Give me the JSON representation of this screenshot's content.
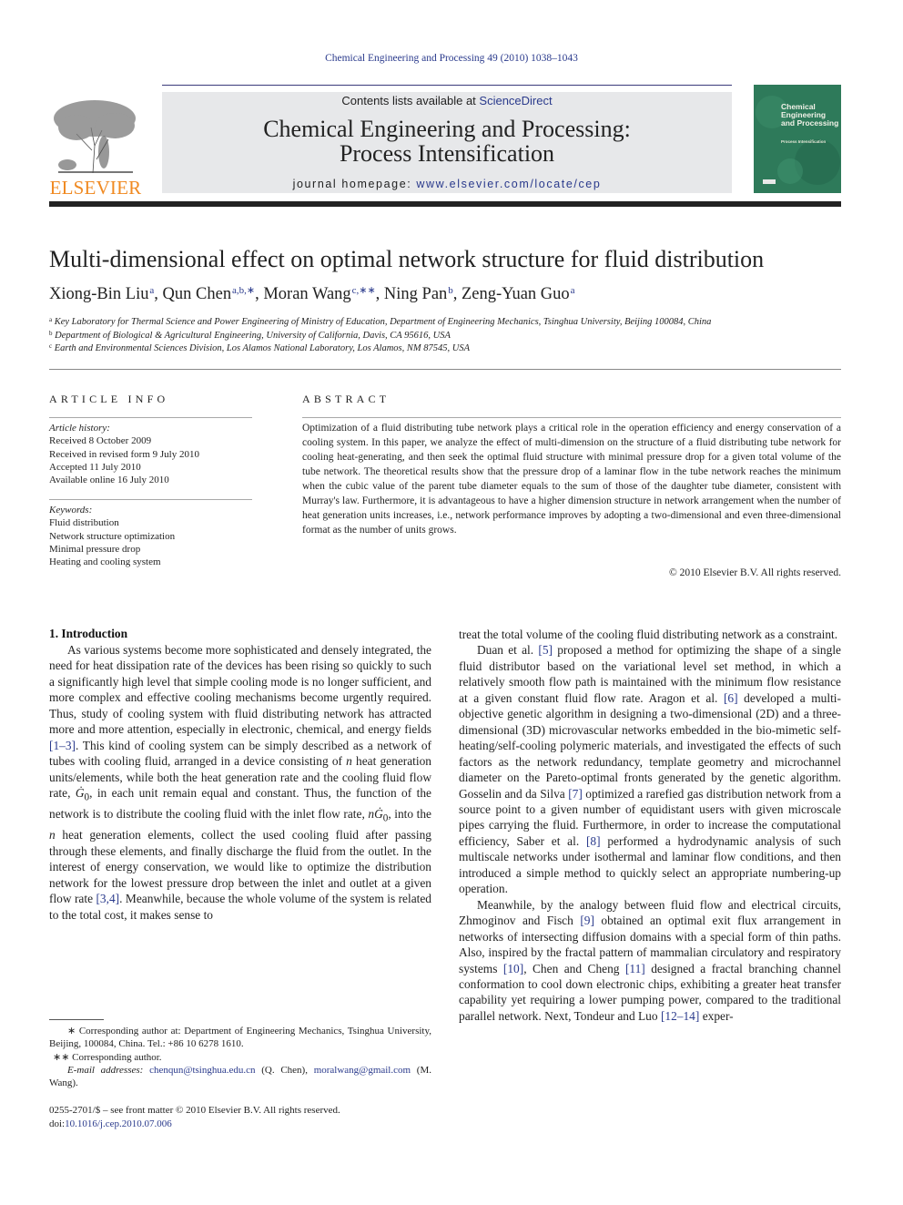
{
  "header": {
    "citation": "Chemical Engineering and Processing 49 (2010) 1038–1043",
    "contents_prefix": "Contents lists available at ",
    "contents_link": "ScienceDirect",
    "journal_title_line1": "Chemical Engineering and Processing:",
    "journal_title_line2": "Process Intensification",
    "homepage_prefix": "journal homepage: ",
    "homepage_url": "www.elsevier.com/locate/cep",
    "publisher_logo_text": "ELSEVIER",
    "cover_title": "Chemical Engineering and Processing",
    "cover_subtitle": "Process Intensification",
    "colors": {
      "publisher_orange": "#f08a22",
      "link_blue": "#2a3a8c",
      "masthead_gray": "#e7e8ea",
      "cover_green": "#2e7a5a"
    }
  },
  "article": {
    "title": "Multi-dimensional effect on optimal network structure for fluid distribution",
    "authors": [
      {
        "name": "Xiong-Bin Liu",
        "sup": "a"
      },
      {
        "name": "Qun Chen",
        "sup": "a,b,∗"
      },
      {
        "name": "Moran Wang",
        "sup": "c,∗∗"
      },
      {
        "name": "Ning Pan",
        "sup": "b"
      },
      {
        "name": "Zeng-Yuan Guo",
        "sup": "a"
      }
    ],
    "affiliations": [
      {
        "mark": "a",
        "text": "Key Laboratory for Thermal Science and Power Engineering of Ministry of Education, Department of Engineering Mechanics, Tsinghua University, Beijing 100084, China"
      },
      {
        "mark": "b",
        "text": "Department of Biological & Agricultural Engineering, University of California, Davis, CA 95616, USA"
      },
      {
        "mark": "c",
        "text": "Earth and Environmental Sciences Division, Los Alamos National Laboratory, Los Alamos, NM 87545, USA"
      }
    ]
  },
  "article_info": {
    "heading": "ARTICLE INFO",
    "history_label": "Article history:",
    "history": [
      "Received 8 October 2009",
      "Received in revised form 9 July 2010",
      "Accepted 11 July 2010",
      "Available online 16 July 2010"
    ],
    "keywords_label": "Keywords:",
    "keywords": [
      "Fluid distribution",
      "Network structure optimization",
      "Minimal pressure drop",
      "Heating and cooling system"
    ]
  },
  "abstract": {
    "heading": "ABSTRACT",
    "text": "Optimization of a fluid distributing tube network plays a critical role in the operation efficiency and energy conservation of a cooling system. In this paper, we analyze the effect of multi-dimension on the structure of a fluid distributing tube network for cooling heat-generating, and then seek the optimal fluid structure with minimal pressure drop for a given total volume of the tube network. The theoretical results show that the pressure drop of a laminar flow in the tube network reaches the minimum when the cubic value of the parent tube diameter equals to the sum of those of the daughter tube diameter, consistent with Murray's law. Furthermore, it is advantageous to have a higher dimension structure in network arrangement when the number of heat generation units increases, i.e., network performance improves by adopting a two-dimensional and even three-dimensional format as the number of units grows.",
    "copyright": "© 2010 Elsevier B.V. All rights reserved."
  },
  "body": {
    "section_heading": "1.  Introduction",
    "left": {
      "p1_a": "As various systems become more sophisticated and densely integrated, the need for heat dissipation rate of the devices has been rising so quickly to such a significantly high level that simple cooling mode is no longer sufficient, and more complex and effective cooling mechanisms become urgently required. Thus, study of cooling system with fluid distributing network has attracted more and more attention, especially in electronic, chemical, and energy fields ",
      "cite_1": "[1–3]",
      "p1_b": ". This kind of cooling system can be simply described as a network of tubes with cooling fluid, arranged in a device consisting of ",
      "n1": "n",
      "p1_c": " heat generation units/elements, while both the heat generation rate and the cooling fluid flow rate, ",
      "g0_1": "Ġ",
      "g0_sub": "0",
      "p1_d": ", in each unit remain equal and constant. Thus, the function of the network is to distribute the cooling fluid with the inlet flow rate, ",
      "n2": "n",
      "g0_2": "Ġ",
      "p1_e": ", into the ",
      "n3": "n",
      "p1_f": " heat generation elements, collect the used cooling fluid after passing through these elements, and finally discharge the fluid from the outlet. In the interest of energy conservation, we would like to optimize the distribution network for the lowest pressure drop between the inlet and outlet at a given flow rate ",
      "cite_2": "[3,4]",
      "p1_g": ". Meanwhile, because the whole volume of the system is related to the total cost, it makes sense to"
    },
    "right": {
      "p0": "treat the total volume of the cooling fluid distributing network as a constraint.",
      "p2_a": "Duan et al. ",
      "cite_5": "[5]",
      "p2_b": " proposed a method for optimizing the shape of a single fluid distributor based on the variational level set method, in which a relatively smooth flow path is maintained with the minimum flow resistance at a given constant fluid flow rate. Aragon et al. ",
      "cite_6": "[6]",
      "p2_c": " developed a multi-objective genetic algorithm in designing a two-dimensional (2D) and a three-dimensional (3D) microvascular networks embedded in the bio-mimetic self-heating/self-cooling polymeric materials, and investigated the effects of such factors as the network redundancy, template geometry and microchannel diameter on the Pareto-optimal fronts generated by the genetic algorithm. Gosselin and da Silva ",
      "cite_7": "[7]",
      "p2_d": " optimized a rarefied gas distribution network from a source point to a given number of equidistant users with given microscale pipes carrying the fluid. Furthermore, in order to increase the computational efficiency, Saber et al. ",
      "cite_8": "[8]",
      "p2_e": " performed a hydrodynamic analysis of such multiscale networks under isothermal and laminar flow conditions, and then introduced a simple method to quickly select an appropriate numbering-up operation.",
      "p3_a": "Meanwhile, by the analogy between fluid flow and electrical circuits, Zhmoginov and Fisch ",
      "cite_9": "[9]",
      "p3_b": " obtained an optimal exit flux arrangement in networks of intersecting diffusion domains with a special form of thin paths. Also, inspired by the fractal pattern of mammalian circulatory and respiratory systems ",
      "cite_10": "[10]",
      "p3_c": ", Chen and Cheng ",
      "cite_11": "[11]",
      "p3_d": " designed a fractal branching channel conformation to cool down electronic chips, exhibiting a greater heat transfer capability yet requiring a lower pumping power, compared to the traditional parallel network. Next, Tondeur and Luo ",
      "cite_12": "[12–14]",
      "p3_e": " exper-"
    }
  },
  "footnotes": {
    "fn1": "∗ Corresponding author at: Department of Engineering Mechanics, Tsinghua University, Beijing, 100084, China. Tel.: +86 10 6278 1610.",
    "fn2": "∗∗ Corresponding author.",
    "email_label": "E-mail addresses: ",
    "email1": "chenqun@tsinghua.edu.cn",
    "email1_owner": " (Q. Chen), ",
    "email2": "moralwang@gmail.com",
    "email2_owner": "(M. Wang).",
    "front_matter": "0255-2701/$ – see front matter © 2010 Elsevier B.V. All rights reserved.",
    "doi_prefix": "doi:",
    "doi": "10.1016/j.cep.2010.07.006"
  }
}
